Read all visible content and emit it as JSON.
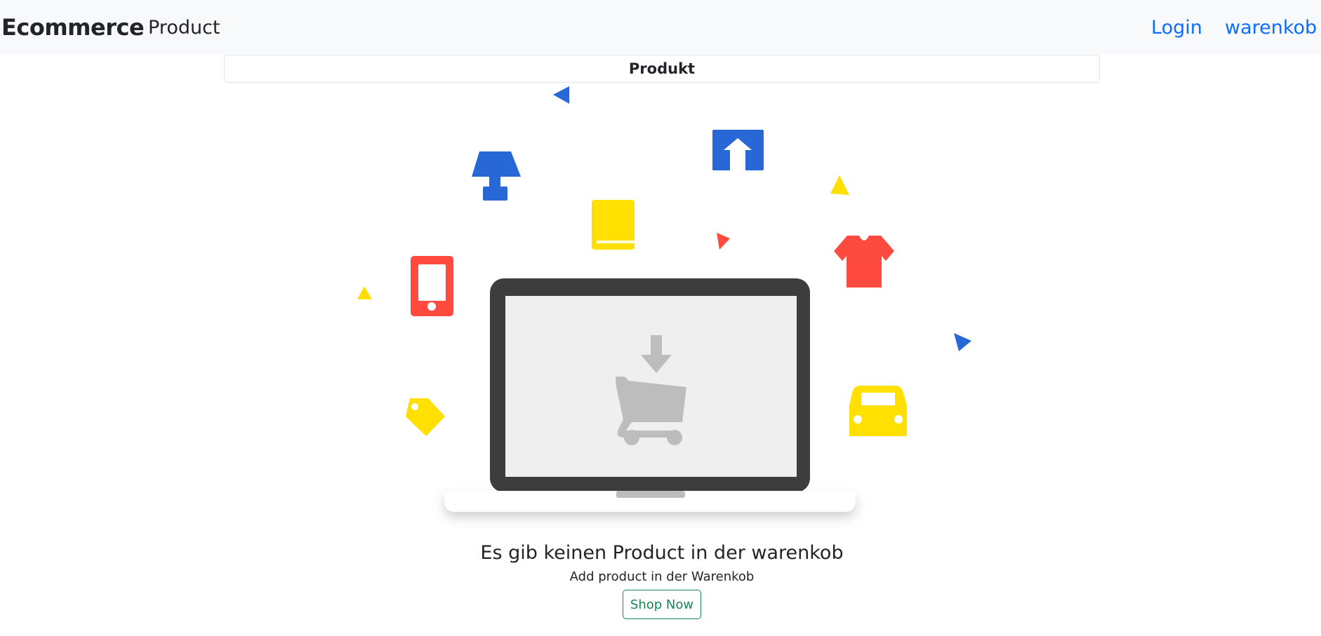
{
  "navbar": {
    "brand": "Ecommerce",
    "product_link": "Product",
    "login_link": "Login",
    "cart_link": "warenkob"
  },
  "card": {
    "header": "Produkt"
  },
  "empty_state": {
    "title": "Es gib keinen Product in der warenkob",
    "subtitle": "Add product in der Warenkob",
    "button_label": "Shop Now"
  },
  "colors": {
    "navbar_bg": "#f8f9fa",
    "link": "#0d6efd",
    "button": "#198754",
    "illustration_blue": "#2868d6",
    "illustration_yellow": "#ffe000",
    "illustration_red": "#ff4a40",
    "laptop_dark": "#3d3d3d",
    "cart_gray": "#bdbdbd"
  }
}
